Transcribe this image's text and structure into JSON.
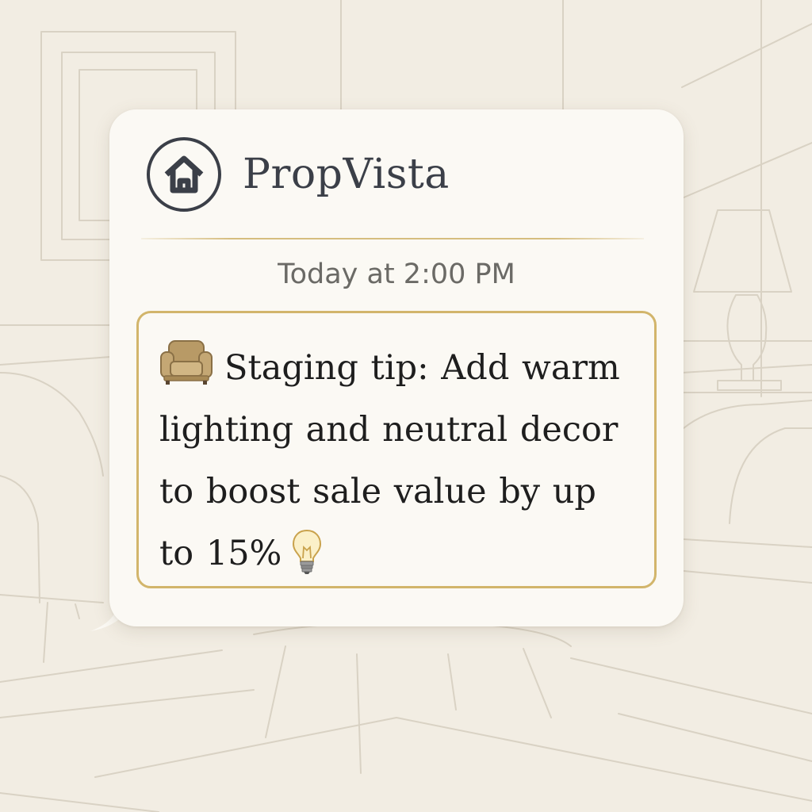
{
  "app": {
    "brand_name": "PropVista",
    "logo_icon": "home-icon"
  },
  "notification": {
    "timestamp": "Today at 2:00 PM",
    "message": "Staging tip: Add warm lighting and neutral decor to boost sale value by up to 15%",
    "leading_icon": "armchair-icon",
    "trailing_icon": "lightbulb-icon"
  },
  "colors": {
    "background": "#f2ede3",
    "bubble": "#fbf9f4",
    "accent_gold": "#d2b56b",
    "brand_text": "#3b3f48",
    "timestamp_text": "#6b6a66",
    "message_text": "#1e1e1e"
  }
}
